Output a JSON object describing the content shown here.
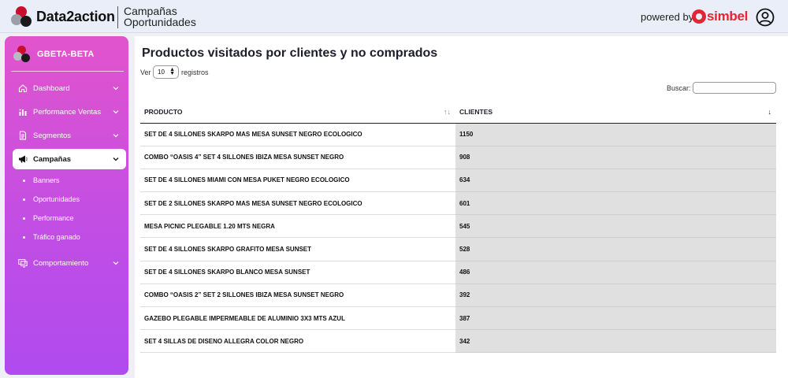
{
  "header": {
    "brand": "Data2action",
    "section_title": "Campañas",
    "section_subtitle": "Oportunidades",
    "powered_by": "powered by",
    "partner": "simbel"
  },
  "sidebar": {
    "workspace": "GBETA-BETA",
    "items": [
      {
        "label": "Dashboard"
      },
      {
        "label": "Performance Ventas"
      },
      {
        "label": "Segmentos"
      },
      {
        "label": "Campañas"
      },
      {
        "label": "Comportamiento"
      }
    ],
    "subitems": [
      {
        "label": "Banners"
      },
      {
        "label": "Oportunidades"
      },
      {
        "label": "Performance"
      },
      {
        "label": "Tráfico ganado"
      }
    ]
  },
  "main": {
    "title": "Productos visitados por clientes y no comprados",
    "length_prefix": "Ver",
    "length_value": "10",
    "length_suffix": "registros",
    "search_label": "Buscar:",
    "search_value": "",
    "columns": [
      "PRODUCTO",
      "CLIENTES"
    ],
    "rows": [
      {
        "product": "SET DE 4 SILLONES SKARPO MAS MESA SUNSET NEGRO ECOLOGICO",
        "clients": "1150"
      },
      {
        "product": "COMBO “OASIS 4” SET 4 SILLONES IBIZA MESA SUNSET NEGRO",
        "clients": "908"
      },
      {
        "product": "SET DE 4 SILLONES MIAMI CON MESA PUKET NEGRO ECOLOGICO",
        "clients": "634"
      },
      {
        "product": "SET DE 2 SILLONES SKARPO MAS MESA SUNSET NEGRO ECOLOGICO",
        "clients": "601"
      },
      {
        "product": "MESA PICNIC PLEGABLE 1.20 MTS NEGRA",
        "clients": "545"
      },
      {
        "product": "SET DE 4 SILLONES SKARPO GRAFITO MESA SUNSET",
        "clients": "528"
      },
      {
        "product": "SET DE 4 SILLONES SKARPO BLANCO MESA SUNSET",
        "clients": "486"
      },
      {
        "product": "COMBO “OASIS 2” SET 2 SILLONES IBIZA MESA SUNSET NEGRO",
        "clients": "392"
      },
      {
        "product": "GAZEBO PLEGABLE IMPERMEABLE DE ALUMINIO 3X3 MTS AZUL",
        "clients": "387"
      },
      {
        "product": "SET 4 SILLAS DE DISENO ALLEGRA COLOR NEGRO",
        "clients": "342"
      }
    ]
  },
  "colors": {
    "sidebar_top": "#e254cc",
    "sidebar_bottom": "#b04bef",
    "partner_red": "#e32636",
    "header_bg": "#e9eef8"
  }
}
